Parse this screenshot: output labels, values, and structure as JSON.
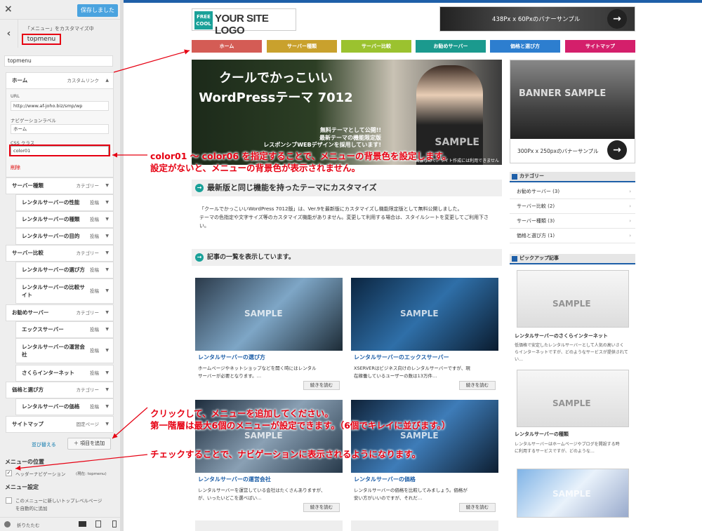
{
  "customizer": {
    "close": "×",
    "save_label": "保存しました",
    "back": "‹",
    "breadcrumb": "「メニュー」をカスタマイズ中",
    "menu_title": "topmenu",
    "menu_name_value": "topmenu",
    "items": [
      {
        "label": "ホーム",
        "type": "カスタムリンク",
        "level": 0
      },
      {
        "label": "サーバー種類",
        "type": "カテゴリー",
        "level": 0
      },
      {
        "label": "レンタルサーバーの性能",
        "type": "投稿",
        "level": 1
      },
      {
        "label": "レンタルサーバーの種類",
        "type": "投稿",
        "level": 1
      },
      {
        "label": "レンタルサーバーの目的",
        "type": "投稿",
        "level": 1
      },
      {
        "label": "サーバー比較",
        "type": "カテゴリー",
        "level": 0
      },
      {
        "label": "レンタルサーバーの選び方",
        "type": "投稿",
        "level": 1
      },
      {
        "label": "レンタルサーバーの比較サイト",
        "type": "投稿",
        "level": 1
      },
      {
        "label": "お勧めサーバー",
        "type": "カテゴリー",
        "level": 0
      },
      {
        "label": "エックスサーバー",
        "type": "投稿",
        "level": 1
      },
      {
        "label": "レンタルサーバーの運営会社",
        "type": "投稿",
        "level": 1
      },
      {
        "label": "さくらインターネット",
        "type": "投稿",
        "level": 1
      },
      {
        "label": "価格と選び方",
        "type": "カテゴリー",
        "level": 0
      },
      {
        "label": "レンタルサーバーの価格",
        "type": "投稿",
        "level": 1
      },
      {
        "label": "サイトマップ",
        "type": "固定ページ",
        "level": 0
      }
    ],
    "expanded": {
      "url_label": "URL",
      "url_value": "http://www.af-joho.biz/smp/wp",
      "nav_label": "ナビゲーションラベル",
      "nav_value": "ホーム",
      "css_label": "CSS クラス",
      "css_value": "color01",
      "delete": "削除"
    },
    "reorder": "並び替える",
    "add_item": "＋ 項目を追加",
    "menu_location_heading": "メニューの位置",
    "header_nav_label": "ヘッダーナビゲーション",
    "header_nav_current": "(現在: topmenu)",
    "menu_settings_heading": "メニュー設定",
    "auto_add_label_1": "このメニューに新しいトップレベルページ",
    "auto_add_label_2": "を自動的に追加",
    "collapse": "折りたたむ",
    "checkmark": "✓"
  },
  "site": {
    "logo_free": "FREE",
    "logo_cool": "COOL",
    "logo_text": "YOUR SITE LOGO",
    "top_banner": "438Px x 60Pxのバナーサンプル",
    "arrow": "→",
    "nav": [
      {
        "label": "ホーム",
        "color": "#d45c55"
      },
      {
        "label": "サーバー種類",
        "color": "#c9a12d"
      },
      {
        "label": "サーバー比較",
        "color": "#9bc22f"
      },
      {
        "label": "お勧めサーバー",
        "color": "#1b9a8e"
      },
      {
        "label": "価格と選び方",
        "color": "#2d7ecf"
      },
      {
        "label": "サイトマップ",
        "color": "#d41f6b"
      }
    ],
    "hero": {
      "line1": "クールでかっこいい",
      "line2": "WordPressテーマ 7012",
      "line3": "無料テーマとして公開!!",
      "line4": "最新テーマの機能限定版",
      "line5": "レスポンシブWEBデザインを採用しています!",
      "sample": "SAMPLE",
      "note": "画像なので、サイト作成には利用できません"
    },
    "side_banner_text": "BANNER SAMPLE",
    "side_banner_caption": "300Px x 250pxのバナーサンプル",
    "section_title": "最新版と同じ機能を持ったテーマにカスタマイズ",
    "intro_lines": [
      "「クールでかっこいいWordPress 7012版」は、Ver.9を最新版にカスタマイズし機能限定版として無料公開しました。",
      "テーマの色指定や文字サイズ等のカスタマイズ機能がありません。変更して利用する場合は、スタイルシートを変更してご利用下さい。"
    ],
    "list_title": "記事の一覧を表示しています。",
    "sample": "SAMPLE",
    "posts": [
      {
        "title": "レンタルサーバーの選び方",
        "excerpt1": "ホームページやネットショップなどを開く時にはレンタル",
        "excerpt2": "サーバーが必要となります。…",
        "more": "続きを読む"
      },
      {
        "title": "レンタルサーバーのエックスサーバー",
        "excerpt1": "XSERVERはビジネス向けのレンタルサーバーですが、現",
        "excerpt2": "在稼働しているユーザーの数は13万件…",
        "more": "続きを読む"
      },
      {
        "title": "レンタルサーバーの運営会社",
        "excerpt1": "レンタルサーバーを運営している会社はたくさんありますが、",
        "excerpt2": "が、いったいどこを選べばい…",
        "more": "続きを読む"
      },
      {
        "title": "レンタルサーバーの価格",
        "excerpt1": "レンタルサーバーの価格を比較してみましょう。価格が",
        "excerpt2": "安い方がいいのですが、それだ…",
        "more": "続きを読む"
      }
    ],
    "category_heading": "カテゴリー",
    "categories": [
      "お勧めサーバー (3)",
      "サーバー比較 (2)",
      "サーバー種類 (3)",
      "価格と選び方 (1)"
    ],
    "pickup_heading": "ピックアップ記事",
    "pickups": [
      {
        "title": "レンタルサーバーのさくらインターネット",
        "excerpt1": "低価格で安定したレンタルサーバーとして人気の高いさく",
        "excerpt2": "らインターネットですが、どのようなサービスが提供されてい…"
      },
      {
        "title": "レンタルサーバーの種類",
        "excerpt1": "レンタルサーバーはホームページやブログを開設する時",
        "excerpt2": "に利用するサービスですが、どのような…"
      }
    ]
  },
  "annotations": {
    "css": "color01 ～ color06 を指定することで、メニューの背景色を設定します。",
    "css2": "設定がないと、メニューの背景色が表示されません。",
    "add": "クリックして、メニューを追加してください。",
    "add2": "第一階層は最大6個のメニューが設定できます。（6個でキレイに並びます。）",
    "check": "チェックすることで、ナビゲーションに表示されるようになります。",
    "color": "#e60012"
  }
}
